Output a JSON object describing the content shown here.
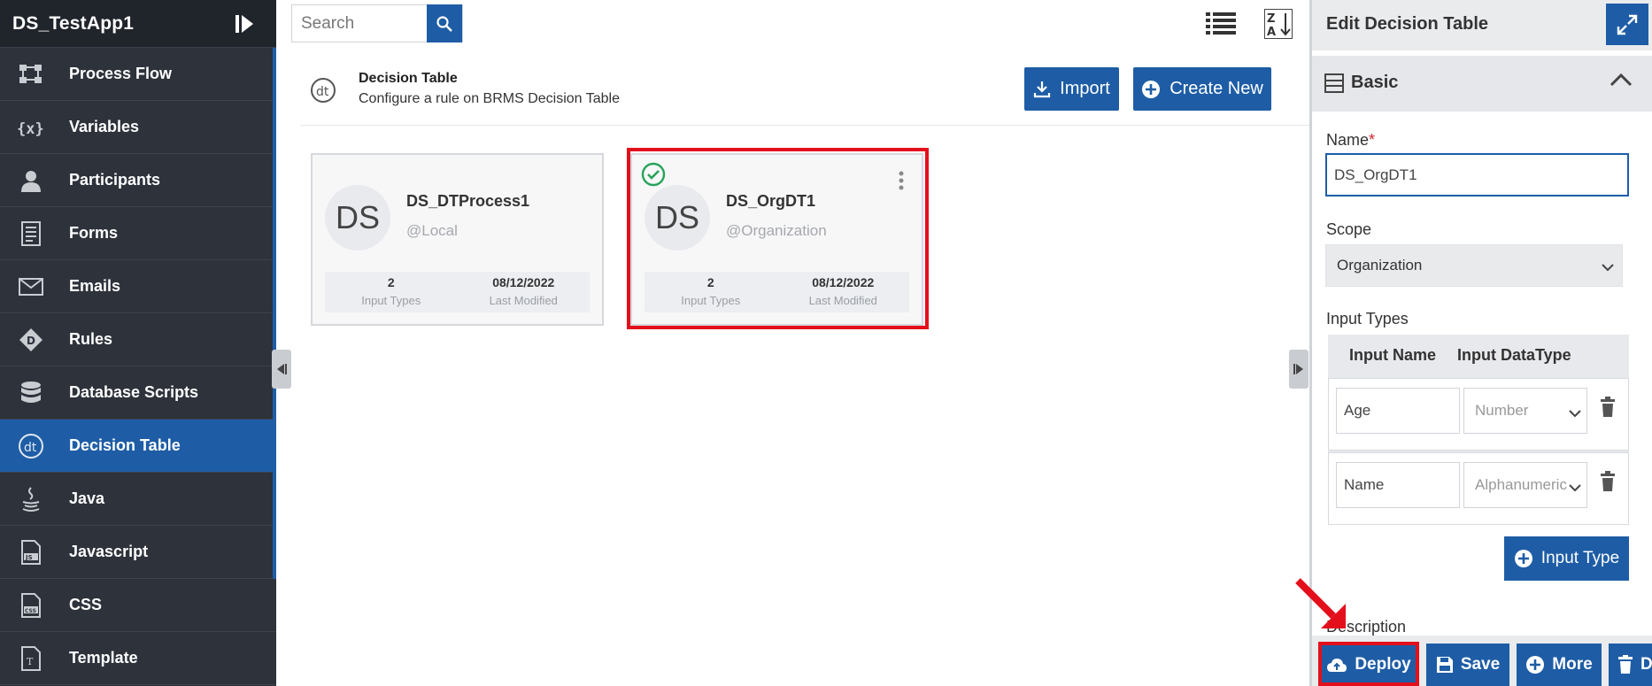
{
  "app": {
    "title": "DS_TestApp1"
  },
  "sidebar": {
    "items": [
      {
        "label": "Process Flow",
        "icon": "process-flow-icon"
      },
      {
        "label": "Variables",
        "icon": "variables-icon"
      },
      {
        "label": "Participants",
        "icon": "participants-icon"
      },
      {
        "label": "Forms",
        "icon": "forms-icon"
      },
      {
        "label": "Emails",
        "icon": "email-icon"
      },
      {
        "label": "Rules",
        "icon": "rules-icon"
      },
      {
        "label": "Database Scripts",
        "icon": "database-icon"
      },
      {
        "label": "Decision Table",
        "icon": "decision-table-icon",
        "active": true
      },
      {
        "label": "Java",
        "icon": "java-icon"
      },
      {
        "label": "Javascript",
        "icon": "javascript-icon"
      },
      {
        "label": "CSS",
        "icon": "css-icon"
      },
      {
        "label": "Template",
        "icon": "template-icon"
      }
    ]
  },
  "toolbar": {
    "search_placeholder": "Search"
  },
  "header": {
    "title": "Decision Table",
    "subtitle": "Configure a rule on BRMS Decision Table",
    "import_label": "Import",
    "create_label": "Create New"
  },
  "cards": [
    {
      "avatar": "DS",
      "name": "DS_DTProcess1",
      "scope": "@Local",
      "input_types": "2",
      "input_types_label": "Input Types",
      "modified": "08/12/2022",
      "modified_label": "Last Modified"
    },
    {
      "avatar": "DS",
      "name": "DS_OrgDT1",
      "scope": "@Organization",
      "input_types": "2",
      "input_types_label": "Input Types",
      "modified": "08/12/2022",
      "modified_label": "Last Modified"
    }
  ],
  "panel": {
    "title": "Edit Decision Table",
    "section": "Basic",
    "name_label": "Name",
    "required_mark": "*",
    "name_value": "DS_OrgDT1",
    "scope_label": "Scope",
    "scope_value": "Organization",
    "input_types_label": "Input Types",
    "col_name": "Input Name",
    "col_type": "Input DataType",
    "rows": [
      {
        "name": "Age",
        "type": "Number"
      },
      {
        "name": "Name",
        "type": "Alphanumeric"
      }
    ],
    "add_input_label": "Input Type",
    "description_label": "Description",
    "deploy_label": "Deploy",
    "save_label": "Save",
    "more_label": "More",
    "delete_label": "D"
  },
  "colors": {
    "primary": "#1e5da6",
    "sidebar": "#2d323b",
    "highlight": "#e3101b",
    "success": "#27a35a"
  }
}
